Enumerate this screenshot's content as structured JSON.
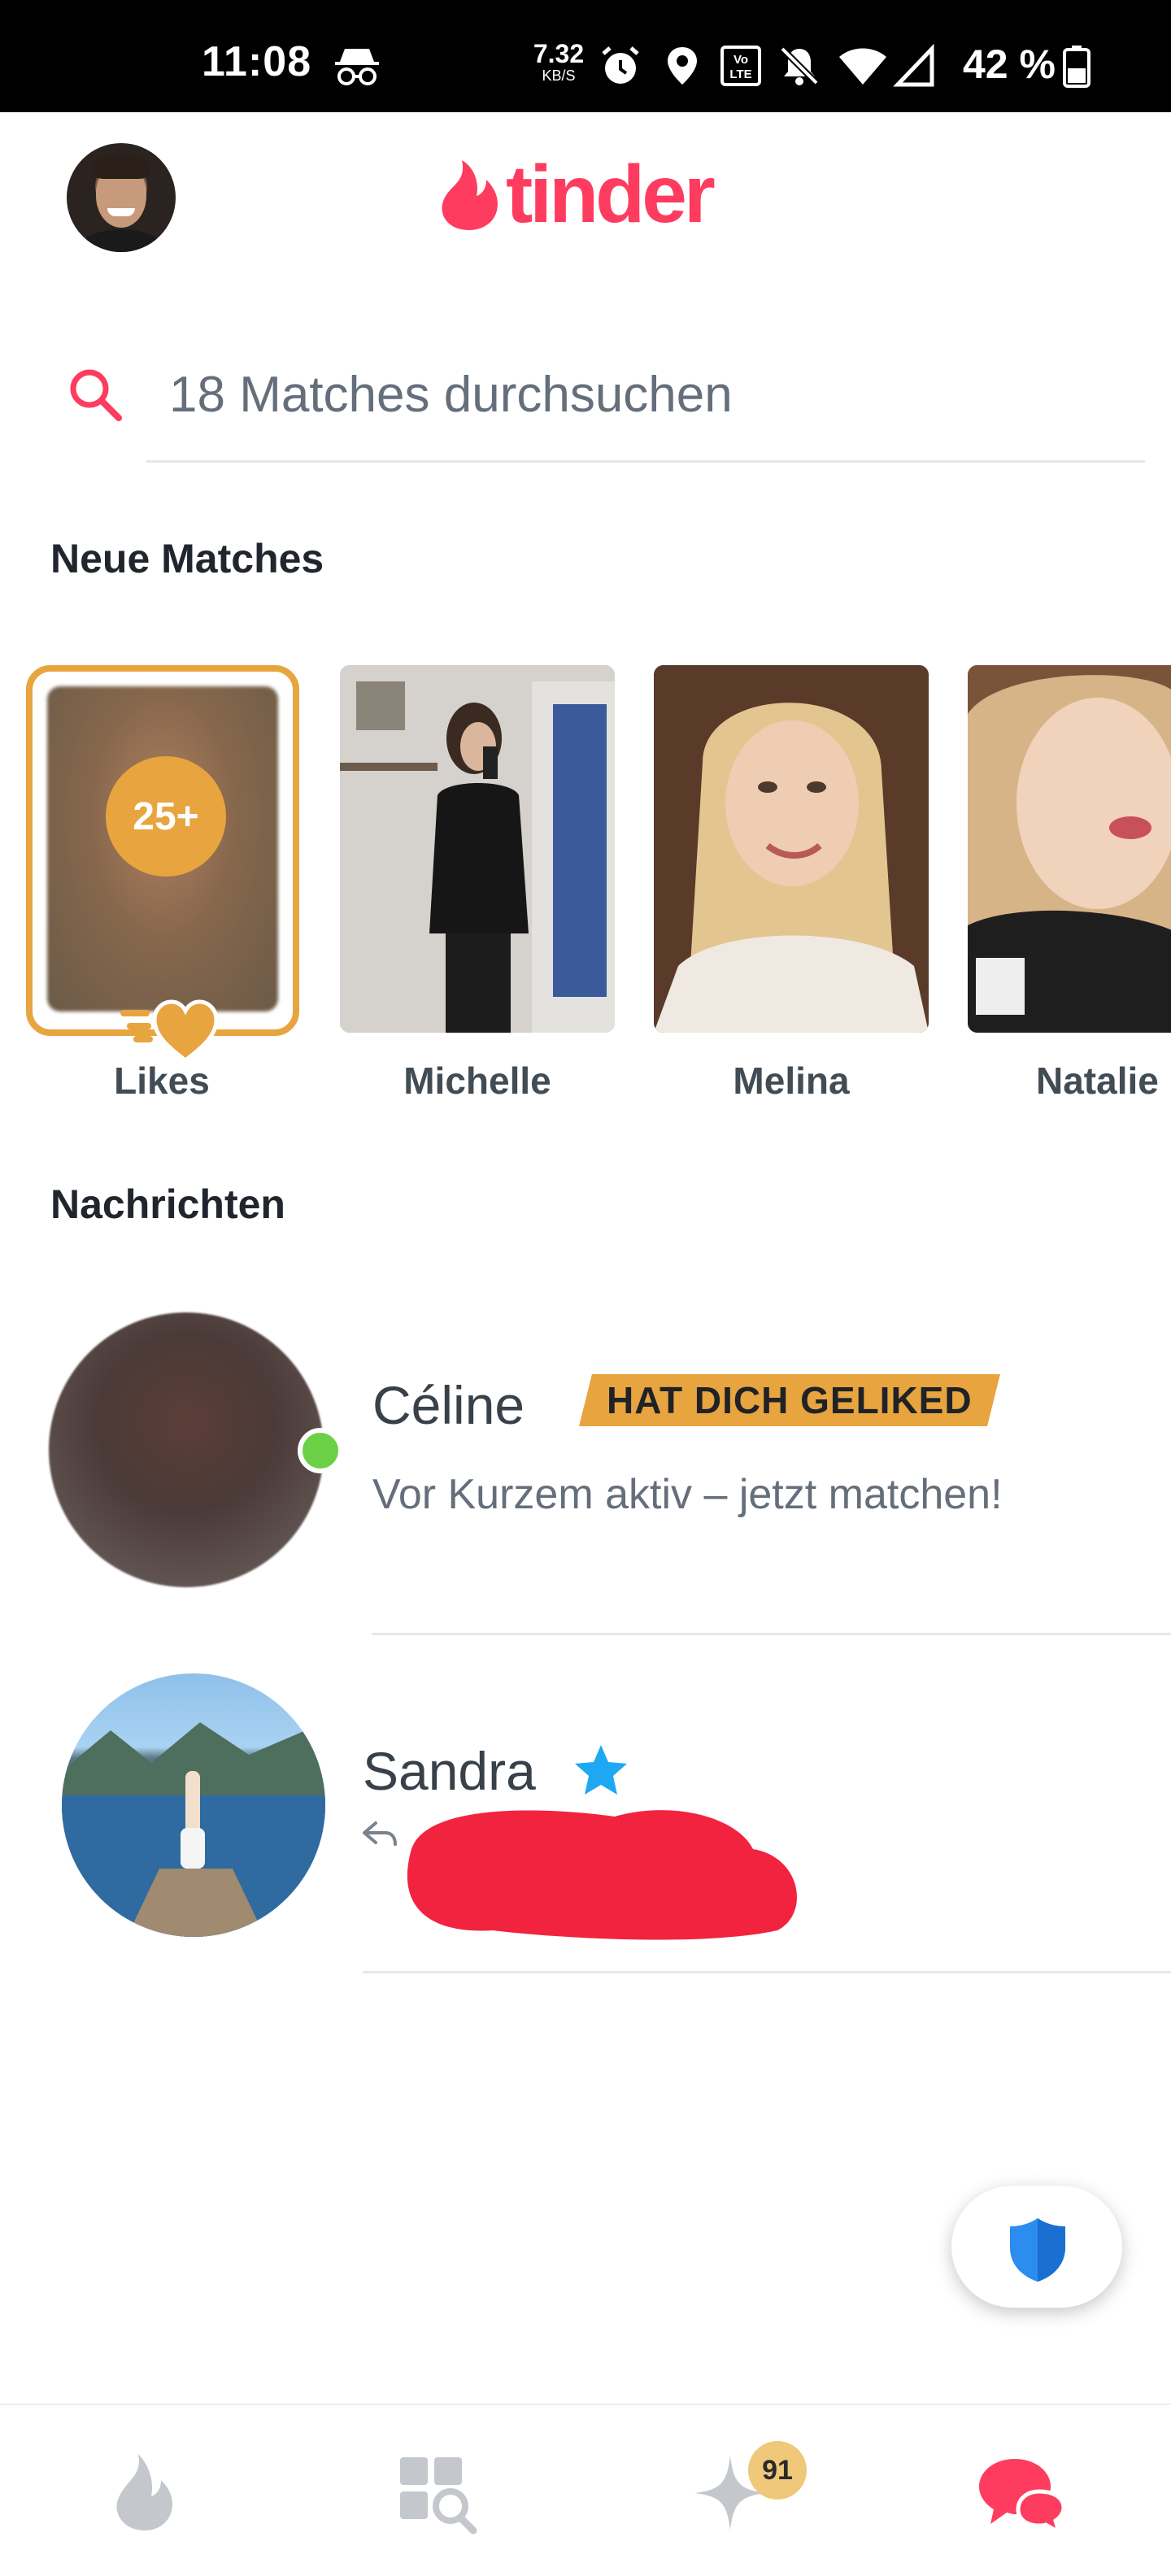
{
  "status_bar": {
    "time": "11:08",
    "net_speed_value": "7.32",
    "net_speed_unit": "KB/S",
    "battery": "42 %",
    "icons": [
      "incognito-icon",
      "alarm-icon",
      "location-icon",
      "volte-icon",
      "mute-icon",
      "wifi-icon",
      "signal-icon",
      "battery-icon"
    ]
  },
  "header": {
    "logo_text": "tinder",
    "brand_color": "#fe3c5f"
  },
  "search": {
    "placeholder": "18 Matches durchsuchen"
  },
  "new_matches": {
    "title": "Neue Matches",
    "likes": {
      "badge": "25+",
      "label": "Likes",
      "color": "#e8a43f"
    },
    "items": [
      {
        "name": "Michelle"
      },
      {
        "name": "Melina"
      },
      {
        "name": "Natalie"
      }
    ]
  },
  "messages": {
    "title": "Nachrichten",
    "items": [
      {
        "name": "Céline",
        "badge": "HAT DICH GELIKED",
        "subtitle": "Vor Kurzem aktiv – jetzt matchen!",
        "online": true
      },
      {
        "name": "Sandra",
        "verified": true,
        "replied": true
      }
    ]
  },
  "fab": {
    "icon": "shield-icon",
    "color": "#2d8cf0"
  },
  "bottom_nav": {
    "items": [
      "flame-icon",
      "explore-icon",
      "gold-star-icon",
      "chat-icon"
    ],
    "gold_badge": "91",
    "active": "chat-icon"
  }
}
